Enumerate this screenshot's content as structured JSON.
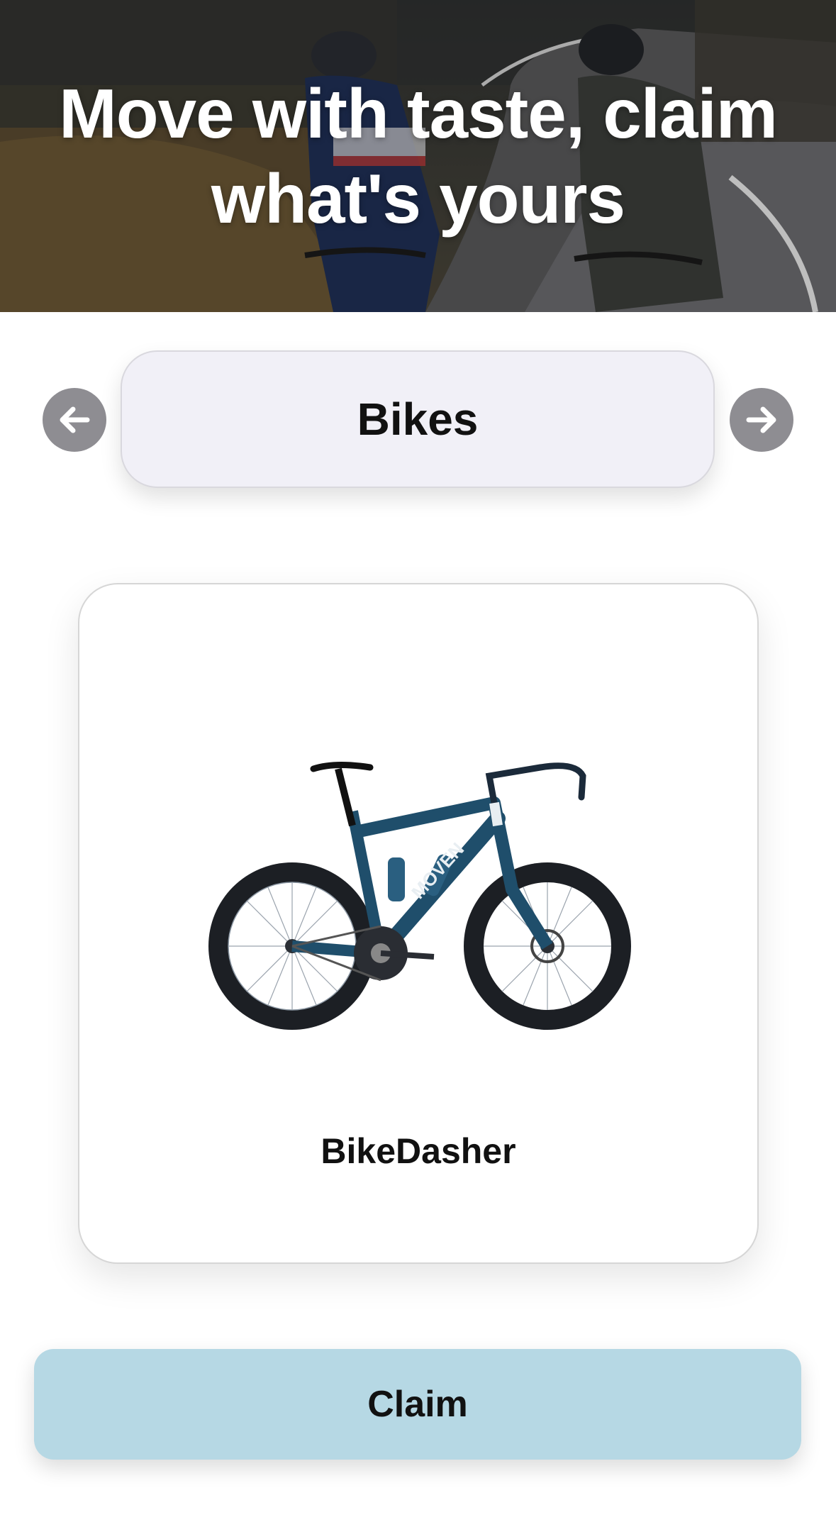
{
  "hero": {
    "title_line1": "Move with taste, claim",
    "title_line2": "what's yours"
  },
  "category": {
    "label": "Bikes",
    "prev_icon": "arrow-left-icon",
    "next_icon": "arrow-right-icon"
  },
  "product": {
    "name": "BikeDasher",
    "image": "road-bike-image",
    "brand_text": "MOVEN"
  },
  "actions": {
    "claim_label": "Claim"
  },
  "colors": {
    "nav_button": "#8e8d92",
    "pill_background": "#f1f0f7",
    "claim_background": "#b6d8e4",
    "bike_frame": "#1f4e6b"
  }
}
